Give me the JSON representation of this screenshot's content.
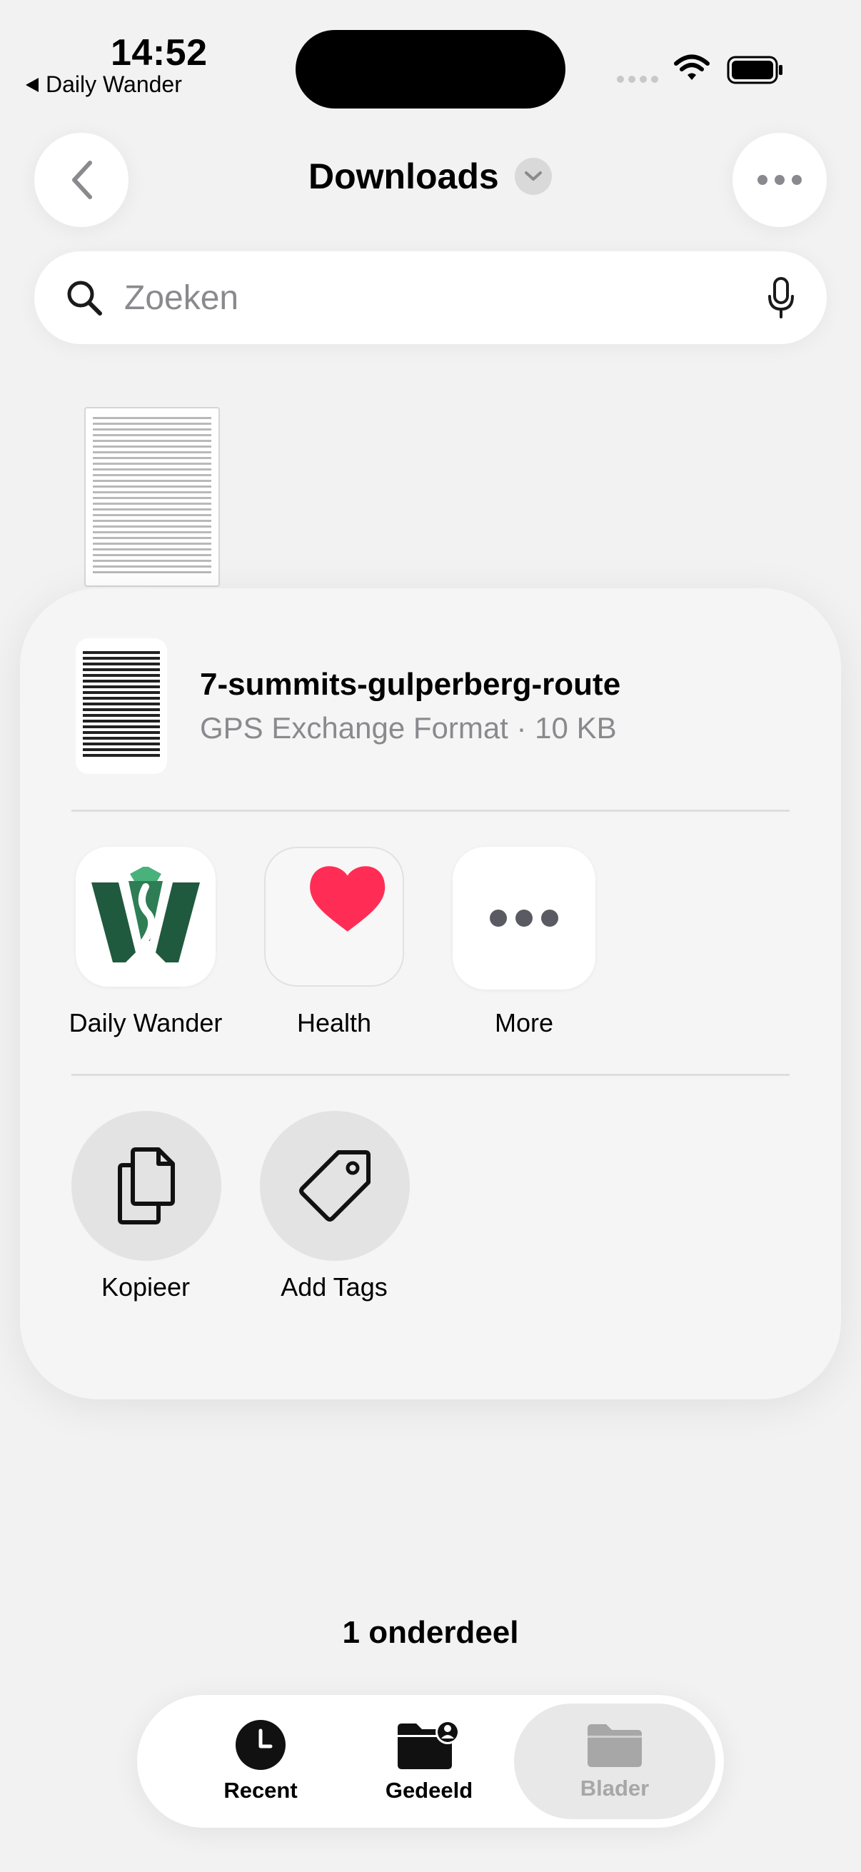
{
  "status_bar": {
    "time": "14:52",
    "back_app": "Daily Wander"
  },
  "nav": {
    "title": "Downloads"
  },
  "search": {
    "placeholder": "Zoeken"
  },
  "share_sheet": {
    "file_name": "7-summits-gulperberg-route",
    "file_meta": "GPS Exchange Format · 10 KB",
    "apps": [
      {
        "label": "Daily Wander",
        "icon": "daily-wander-app-icon"
      },
      {
        "label": "Health",
        "icon": "health-app-icon"
      },
      {
        "label": "More",
        "icon": "more-icon"
      }
    ],
    "actions": [
      {
        "label": "Kopieer",
        "icon": "copy-icon"
      },
      {
        "label": "Add Tags",
        "icon": "tag-icon"
      }
    ]
  },
  "item_count": "1 onderdeel",
  "tab_bar": {
    "tabs": [
      {
        "label": "Recent",
        "icon": "clock-icon"
      },
      {
        "label": "Gedeeld",
        "icon": "shared-folder-icon"
      },
      {
        "label": "Blader",
        "icon": "folder-icon",
        "selected": true
      }
    ]
  },
  "colors": {
    "accent_dark_green": "#1f5a3e",
    "health_heart": "#ff2d55",
    "inactive_tab": "#a7a7a7"
  }
}
